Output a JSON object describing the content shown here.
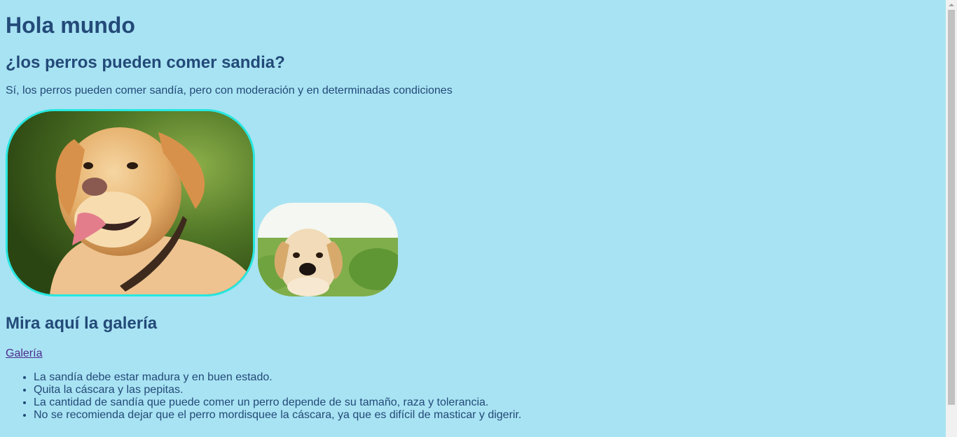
{
  "heading": "Hola mundo",
  "question": "¿los perros pueden comer sandia?",
  "answer": "Sí, los perros pueden comer sandía, pero con moderación y en determinadas condiciones",
  "images": {
    "big_dog": "golden labrador adult dog photo",
    "small_dog": "labrador puppy photo"
  },
  "gallery": {
    "heading": "Mira aquí la galería",
    "link_label": "Galería"
  },
  "tips": [
    "La sandía debe estar madura y en buen estado.",
    "Quita la cáscara y las pepitas.",
    "La cantidad de sandía que puede comer un perro depende de su tamaño, raza y tolerancia.",
    "No se recomienda dejar que el perro mordisquee la cáscara, ya que es difícil de masticar y digerir."
  ],
  "colors": {
    "background": "#a8e3f3",
    "text": "#234a78",
    "link": "#4d2c8f",
    "image_border": "#27e7e0"
  }
}
